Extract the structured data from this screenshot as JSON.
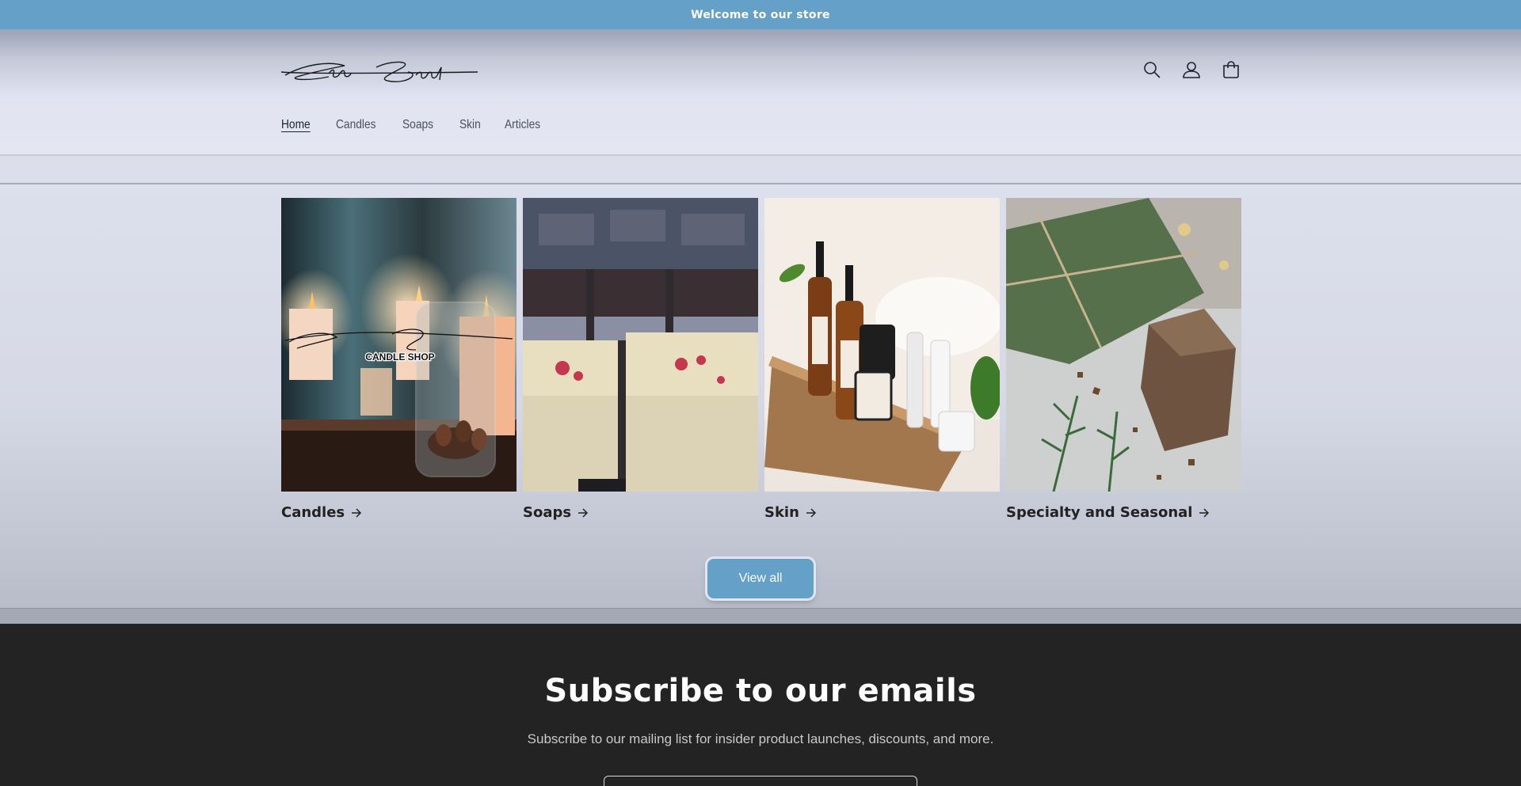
{
  "announcement": "Welcome to our store",
  "brand": {
    "logo_text": "StoneSpark"
  },
  "nav": {
    "items": [
      {
        "label": "Home"
      },
      {
        "label": "Candles"
      },
      {
        "label": "Soaps"
      },
      {
        "label": "Skin"
      },
      {
        "label": "Articles"
      }
    ]
  },
  "header_icons": [
    "search-icon",
    "account-icon",
    "cart-icon"
  ],
  "collections": [
    {
      "title": "Candles",
      "image_logo": "StoneSpark",
      "image_caption": "CANDLE SHOP"
    },
    {
      "title": "Soaps"
    },
    {
      "title": "Skin"
    },
    {
      "title": "Specialty and Seasonal"
    }
  ],
  "view_all_label": "View all",
  "newsletter": {
    "heading": "Subscribe to our emails",
    "subtext": "Subscribe to our mailing list for insider product launches, discounts, and more."
  },
  "colors": {
    "accent": "#64a0c8",
    "footer_bg": "#232323"
  }
}
